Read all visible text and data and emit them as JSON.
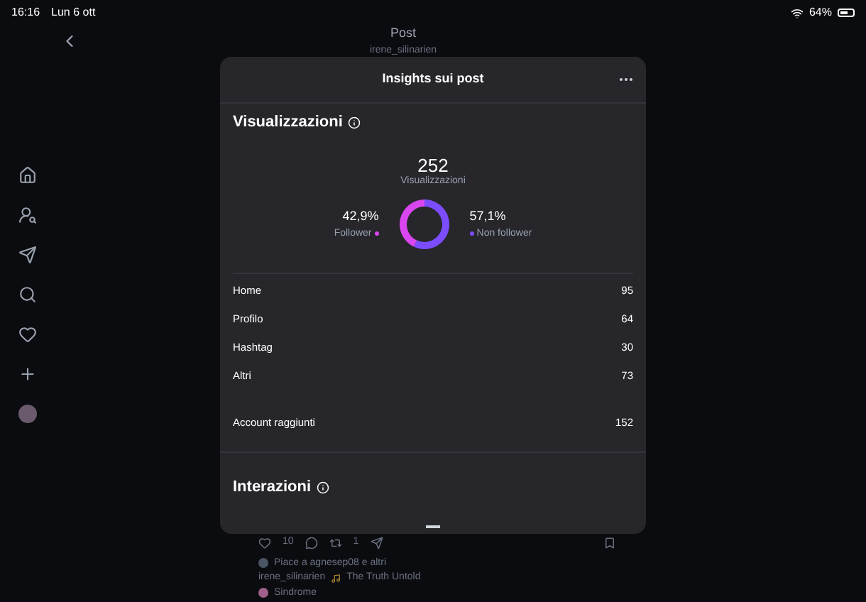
{
  "status_bar": {
    "time": "16:16",
    "date": "Lun 6 ott",
    "battery": "64%"
  },
  "header": {
    "title": "Post",
    "subtitle": "irene_silinarien"
  },
  "modal": {
    "title": "Insights sui post",
    "views": {
      "heading": "Visualizzazioni",
      "total": "252",
      "chart_data": {
        "type": "donut",
        "categories": [
          "Follower",
          "Non follower"
        ],
        "series": [
          {
            "name": "Visualizzazioni",
            "values": [
              42.9,
              57.1
            ]
          }
        ],
        "value_labels": [
          "42,9%",
          "57,1%"
        ]
      },
      "rows": [
        {
          "label": "Home",
          "value": "95"
        },
        {
          "label": "Profilo",
          "value": "64"
        },
        {
          "label": "Hashtag",
          "value": "30"
        },
        {
          "label": "Altri",
          "value": "73"
        }
      ],
      "reach": {
        "label": "Account raggiunti",
        "value": "152"
      }
    },
    "interactions": {
      "heading": "Interazioni"
    }
  },
  "post": {
    "likes": "10",
    "reposts": "1",
    "liked_by": "Piace a agnesep08 e altri",
    "author": "irene_silinarien",
    "song": "The Truth Untold",
    "caption": "Sindrome"
  }
}
